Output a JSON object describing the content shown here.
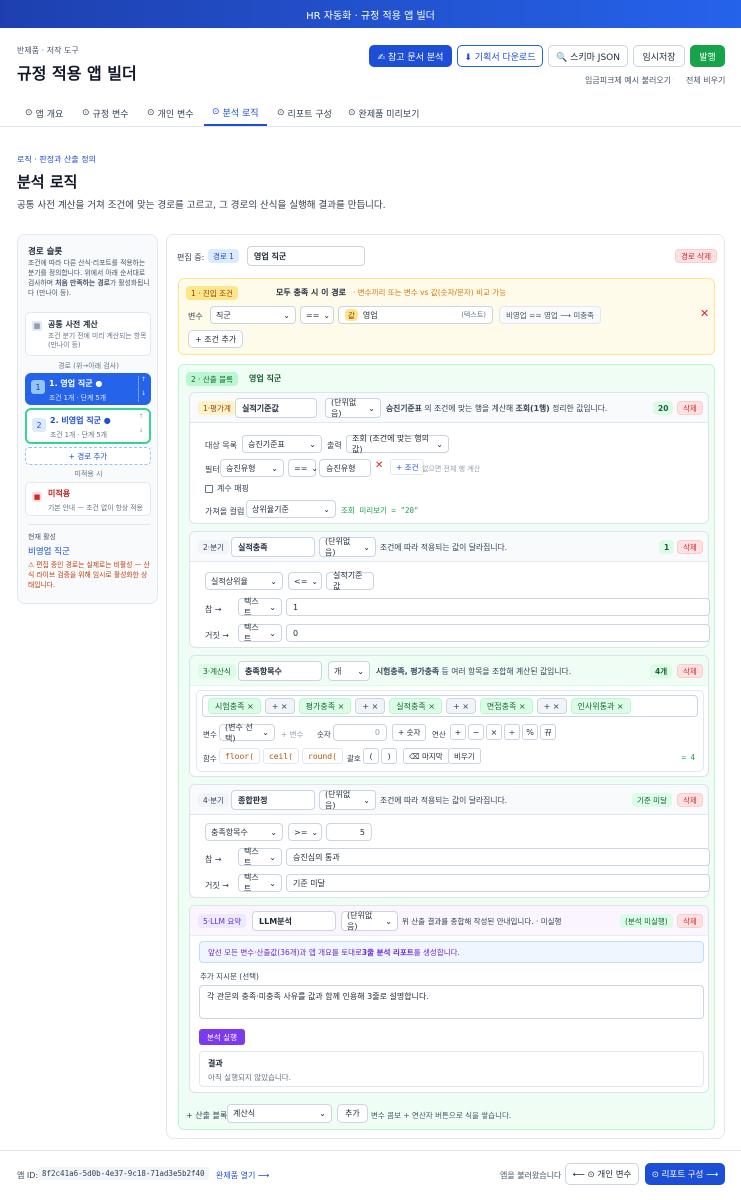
{
  "topbar": {
    "title": "HR 자동화 · 규정 적용 앱 빌더"
  },
  "header": {
    "breadcrumb": "반제품 · 저작 도구",
    "title": "규정 적용 앱 빌더",
    "buttons": {
      "ref": "✍ 참고 문서 분석",
      "download": "⬇ 기획서 다운로드",
      "schema": "🔍 스키마 JSON",
      "temp_save": "임시저장",
      "publish": "발행"
    },
    "links": {
      "load_example": "임금피크제 예시 불러오기",
      "clear_all": "전체 비우기"
    }
  },
  "tabs": [
    {
      "icon": "⊙",
      "label": "앱 개요"
    },
    {
      "icon": "⊙",
      "label": "규정 변수"
    },
    {
      "icon": "⊙",
      "label": "개인 변수"
    },
    {
      "icon": "⊙",
      "label": "분석 로직"
    },
    {
      "icon": "⊙",
      "label": "리포트 구성"
    },
    {
      "icon": "⊙",
      "label": "완제품 미리보기"
    }
  ],
  "section": {
    "breadcrumb": "로직 · 판정과 산출 정의",
    "title": "분석 로직",
    "desc": "공통 사전 계산을 거쳐 조건에 맞는 경로를 고르고, 그 경로의 산식을 실행해 결과를 만듭니다."
  },
  "sidebar": {
    "title": "경로 슬롯",
    "desc1": "조건에 따라 다른 산식·리포트를 적용하는 분기를 정의합니다. 위에서 아래 순서대로 검사하며 ",
    "desc_bold": "처음 만족하는 경로",
    "desc2": "가 활성화됩니다 (만나이 등).",
    "common": {
      "title": "공통 사전 계산",
      "sub": "조건 분기 전에 미리 계산되는 항목 (만나이 등)"
    },
    "order_label": "경로 (위→아래 검사)",
    "routes": [
      {
        "num": "1",
        "name": "1. 영업 직군 ●",
        "sub": "조건 1개 · 단계 5개"
      },
      {
        "num": "2",
        "name": "2. 비영업 직군 ●",
        "sub": "조건 1개 · 단계 5개"
      }
    ],
    "add_route": "+ 경로 추가",
    "unapplied_label": "미적용 시",
    "unapplied": {
      "title": "미적용",
      "sub": "기본 안내 — 조건 없이 항상 적용"
    },
    "current_label": "현재 활성",
    "current_value": "비영업 직군",
    "warning": "⚠ 편집 중인 경로는 실제로는 비활성 — 산식 라이브 검증을 위해 임시로 활성화한 상태입니다."
  },
  "editor": {
    "editing_label": "편집 중:",
    "route_badge": "경로 1",
    "route_name": "영업 직군",
    "delete_route": "경로 삭제",
    "cond": {
      "num_tag": "1 · 진입 조건",
      "title": "모두 충족 시 이 경로",
      "hint": "· 변수끼리 또는 변수 vs 값(숫자/문자) 비교 가능",
      "var_label": "변수",
      "var_value": "직군",
      "op": "==",
      "val_tag": "값",
      "val_value": "영업",
      "val_type": "(텍스트)",
      "preview": "비영업 == 영업 ⟶ 미충족",
      "add": "+ 조건 추가"
    },
    "calc": {
      "num_tag": "2 · 산출 블록",
      "route": "영업 직군",
      "b1": {
        "tag": "1·평가계",
        "name": "실적기준값",
        "unit": "(단위없음)",
        "desc_pre": "",
        "desc_bold1": "승진기준표",
        "desc_mid": " 의 조건에 맞는 행을 계산해 ",
        "desc_bold2": "조회(1행)",
        "desc_post": " 정리한 값입니다.",
        "value": "20",
        "delete": "삭제",
        "target_label": "대상 목록",
        "target": "승진기준표",
        "output_label": "출력",
        "output": "조회 (조건에 맞는 행의 값)",
        "filter_label": "필터",
        "filter_col": "승진유형",
        "filter_op": "==",
        "filter_val": "승진유형",
        "add_cond": "+ 조건",
        "filter_hint": "없으면 전체 행 계산",
        "cumulative": "계수 매핑",
        "col_label": "가져올 컬럼",
        "col": "상위율기준",
        "preview": "조회 미리보기 = \"20\""
      },
      "b2": {
        "tag": "2·분기",
        "name": "실적충족",
        "unit": "(단위없음)",
        "desc": "조건에 따라 적용되는 값이 달라집니다.",
        "value": "1",
        "delete": "삭제",
        "left": "실적상위율",
        "op": "<=",
        "right": "실적기준값",
        "true_label": "참 →",
        "true_type": "텍스트",
        "true_val": "1",
        "false_label": "거짓 →",
        "false_type": "텍스트",
        "false_val": "0"
      },
      "b3": {
        "tag": "3·계산식",
        "name": "충족항목수",
        "unit": "개",
        "desc_bold": "시험충족, 평가충족",
        "desc_post": " 등 여러 항목을 조합해 계산된 값입니다.",
        "value": "4개",
        "delete": "삭제",
        "chips": [
          {
            "t": "시험충족 ×",
            "k": "g"
          },
          {
            "t": "+ ×",
            "k": "s"
          },
          {
            "t": "평가충족 ×",
            "k": "g"
          },
          {
            "t": "+ ×",
            "k": "s"
          },
          {
            "t": "실적충족 ×",
            "k": "g"
          },
          {
            "t": "+ ×",
            "k": "s"
          },
          {
            "t": "면접충족 ×",
            "k": "g"
          },
          {
            "t": "+ ×",
            "k": "s"
          },
          {
            "t": "인사위통과 ×",
            "k": "g"
          }
        ],
        "var_label": "변수",
        "var_select": "(변수 선택)",
        "add_var": "+ 변수",
        "num_label": "숫자",
        "num_val": "0",
        "add_num": "+ 숫자",
        "op_label": "연산",
        "ops": [
          "+",
          "−",
          "×",
          "÷",
          "%",
          "뀨"
        ],
        "fn_label": "함수",
        "fns": [
          "floor(",
          "ceil(",
          "round("
        ],
        "paren_label": "괄호",
        "parens": [
          "(",
          ")"
        ],
        "backspace": "⌫ 마지막",
        "clear": "비우기",
        "result": "= 4"
      },
      "b4": {
        "tag": "4·분기",
        "name": "종합판정",
        "unit": "(단위없음)",
        "desc": "조건에 따라 적용되는 값이 달라집니다.",
        "value": "기준 미달",
        "delete": "삭제",
        "left": "충족항목수",
        "op": ">=",
        "right": "5",
        "true_label": "참 →",
        "true_type": "텍스트",
        "true_val": "승진심의 통과",
        "false_label": "거짓 →",
        "false_type": "텍스트",
        "false_val": "기준 미달"
      },
      "b5": {
        "tag": "5·LLM 요약",
        "name": "LLM분석",
        "unit": "(단위없음)",
        "desc": "위 산출 결과를 종합해 작성된 안내입니다. · 미실행",
        "value": "(분석 미실행)",
        "delete": "삭제",
        "notice_pre": "앞선 모든 변수·산출값(36개)과 앱 개요를 토대로 ",
        "notice_bold": "3줄 분석 리포트",
        "notice_post": "를 생성합니다.",
        "prompt_label": "추가 지시문 (선택)",
        "prompt": "각 관문의 충족·미충족 사유를 값과 함께 인용해 3줄로 설명합니다.",
        "run": "분석 실행",
        "result_label": "결과",
        "result_text": "아직 실행되지 않았습니다."
      },
      "add": {
        "label": "+ 산출 블록",
        "type": "계산식",
        "button": "추가",
        "hint": "변수 콤보 + 연산자 버튼으로 식을 쌓습니다."
      }
    }
  },
  "footer": {
    "app_id_label": "앱 ID:",
    "app_id": "8f2c41a6-5d0b-4e37-9c18-71ad3e5b2f40",
    "open_done": "완제품 열기 ⟶",
    "loaded": "앱을 불러왔습니다",
    "prev": "⟵ ⊙ 개인 변수",
    "next": "⊙ 리포트 구성 ⟶"
  },
  "colors": {
    "primary": "#1d4ed8",
    "green": "#16a34a",
    "danger": "#dc2626",
    "amber": "#f59e0b"
  }
}
